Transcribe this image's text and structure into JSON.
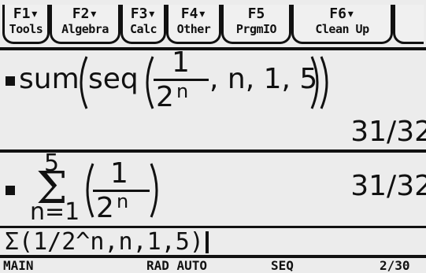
{
  "toolbar": {
    "items": [
      {
        "key": "F1▾",
        "label": "Tools"
      },
      {
        "key": "F2▾",
        "label": "Algebra"
      },
      {
        "key": "F3▾",
        "label": "Calc"
      },
      {
        "key": "F4▾",
        "label": "Other"
      },
      {
        "key": "F5",
        "label": "PrgmIO"
      },
      {
        "key": "F6▾",
        "label": "Clean Up"
      }
    ]
  },
  "history": {
    "entry1": {
      "func_outer": "sum",
      "func_inner": "seq",
      "numerator": "1",
      "denominator_base": "2",
      "denominator_exp": "n",
      "args": ", n, 1, 5",
      "result": "31/32"
    },
    "entry2": {
      "upper": "5",
      "lower": "n=1",
      "numerator": "1",
      "denominator_base": "2",
      "denominator_exp": "n",
      "result": "31/32"
    }
  },
  "entry_line": {
    "text": "Σ(1/2^n,n,1,5)"
  },
  "status_bar": {
    "folder": "MAIN",
    "mode": "RAD AUTO",
    "graph_mode": "SEQ",
    "history_count": "2/30"
  }
}
